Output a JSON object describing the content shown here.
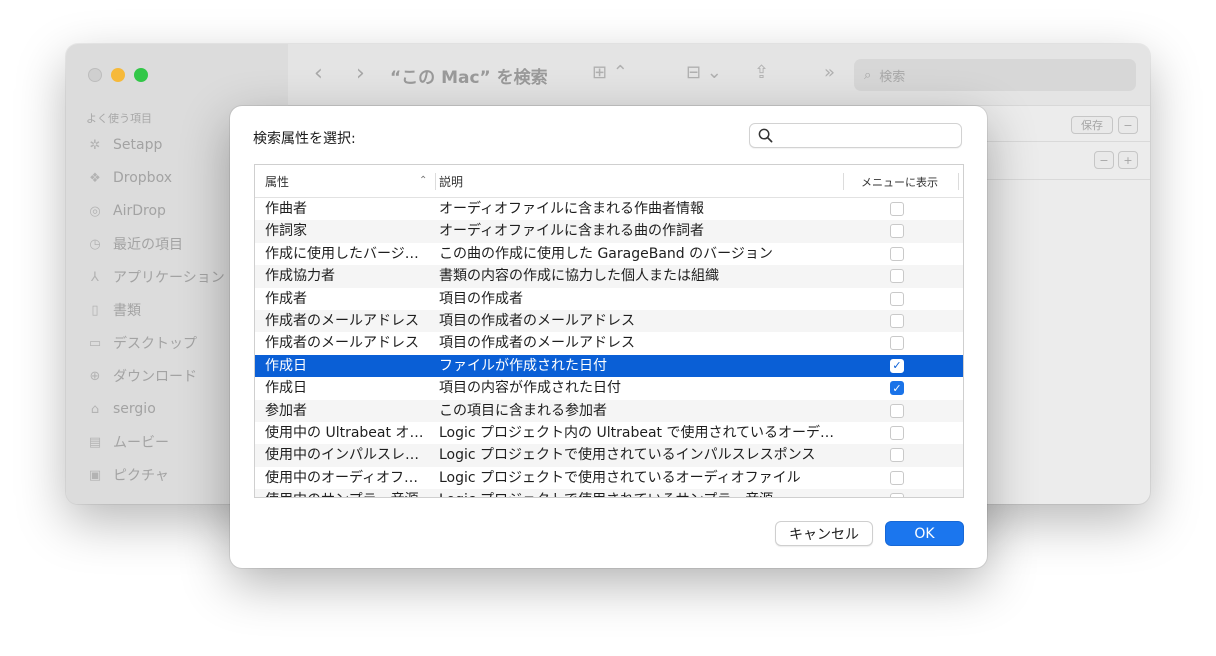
{
  "finder": {
    "title": "“この Mac” を検索",
    "search_placeholder": "検索",
    "save_label": "保存",
    "minus_label": "−",
    "plus_label": "+",
    "sidebar_heading": "よく使う項目",
    "sidebar_items": [
      {
        "label": "Setapp",
        "icon": "setapp-icon"
      },
      {
        "label": "Dropbox",
        "icon": "dropbox-icon"
      },
      {
        "label": "AirDrop",
        "icon": "airdrop-icon"
      },
      {
        "label": "最近の項目",
        "icon": "clock-icon"
      },
      {
        "label": "アプリケーション",
        "icon": "applications-icon"
      },
      {
        "label": "書類",
        "icon": "document-icon"
      },
      {
        "label": "デスクトップ",
        "icon": "desktop-icon"
      },
      {
        "label": "ダウンロード",
        "icon": "download-icon"
      },
      {
        "label": "sergio",
        "icon": "home-icon"
      },
      {
        "label": "ムービー",
        "icon": "movie-icon"
      },
      {
        "label": "ピクチャ",
        "icon": "picture-icon"
      }
    ]
  },
  "dialog": {
    "title": "検索属性を選択:",
    "search_value": "",
    "columns": {
      "attribute": "属性",
      "description": "説明",
      "show_in_menu": "メニューに表示"
    },
    "rows": [
      {
        "attr": "作曲者",
        "desc": "オーディオファイルに含まれる作曲者情報",
        "checked": false,
        "selected": false
      },
      {
        "attr": "作詞家",
        "desc": "オーディオファイルに含まれる曲の作詞者",
        "checked": false,
        "selected": false
      },
      {
        "attr": "作成に使用したバージ…",
        "desc": "この曲の作成に使用した GarageBand のバージョン",
        "checked": false,
        "selected": false
      },
      {
        "attr": "作成協力者",
        "desc": "書類の内容の作成に協力した個人または組織",
        "checked": false,
        "selected": false
      },
      {
        "attr": "作成者",
        "desc": "項目の作成者",
        "checked": false,
        "selected": false
      },
      {
        "attr": "作成者のメールアドレス",
        "desc": "項目の作成者のメールアドレス",
        "checked": false,
        "selected": false
      },
      {
        "attr": "作成者のメールアドレス",
        "desc": "項目の作成者のメールアドレス",
        "checked": false,
        "selected": false
      },
      {
        "attr": "作成日",
        "desc": "ファイルが作成された日付",
        "checked": true,
        "selected": true
      },
      {
        "attr": "作成日",
        "desc": "項目の内容が作成された日付",
        "checked": true,
        "selected": false
      },
      {
        "attr": "参加者",
        "desc": "この項目に含まれる参加者",
        "checked": false,
        "selected": false
      },
      {
        "attr": "使用中の Ultrabeat オー…",
        "desc": "Logic プロジェクト内の Ultrabeat で使用されているオーデ…",
        "checked": false,
        "selected": false
      },
      {
        "attr": "使用中のインパルスレ…",
        "desc": "Logic プロジェクトで使用されているインパルスレスポンス",
        "checked": false,
        "selected": false
      },
      {
        "attr": "使用中のオーディオフ…",
        "desc": "Logic プロジェクトで使用されているオーディオファイル",
        "checked": false,
        "selected": false
      },
      {
        "attr": "使用中のサンプラー音源",
        "desc": "Logic プロジェクトで使用されているサンプラー音源",
        "checked": false,
        "selected": false
      }
    ],
    "cancel_label": "キャンセル",
    "ok_label": "OK"
  }
}
